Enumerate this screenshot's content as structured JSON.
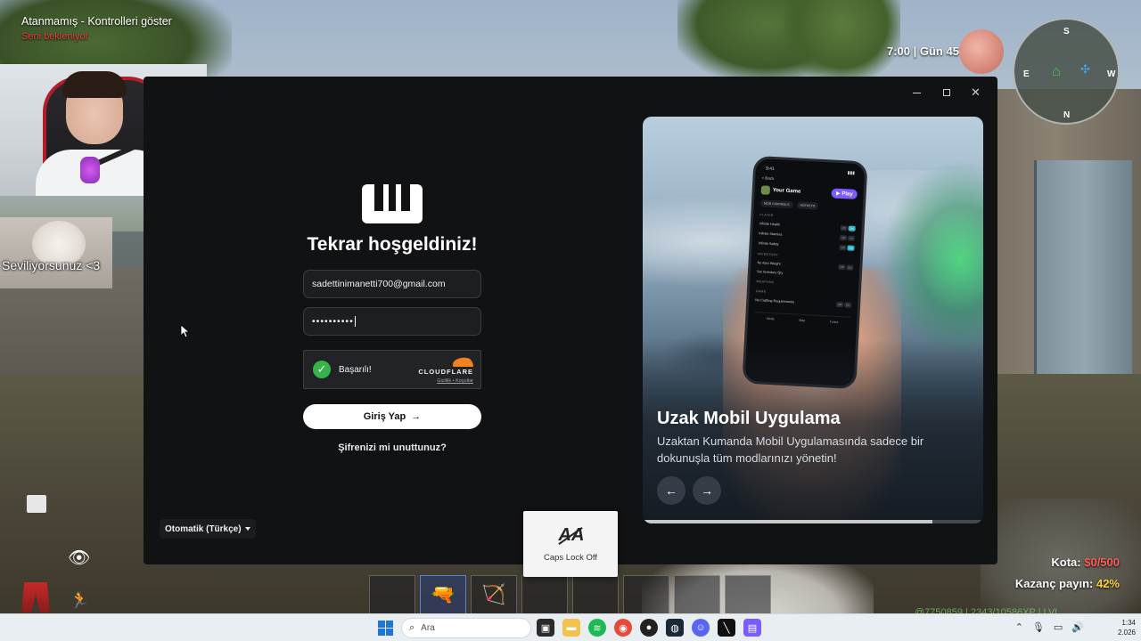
{
  "game": {
    "player_status": "Atanmamış - Kontrolleri göster",
    "sub_status": "Seni bekleniyor",
    "time_day": "7:00 | Gün 45",
    "compass": {
      "s": "S",
      "n": "N",
      "e": "E",
      "w": "W"
    },
    "hotbar_items": [
      "",
      "🔫",
      "🏹",
      "",
      "",
      "",
      "",
      ""
    ],
    "quota_label": "Kota:",
    "quota_value": "$0/500",
    "earnings_label": "Kazanç payın:",
    "earnings_value": "42%",
    "xp_line": "@7750859 | 2343/10586XP | LVL"
  },
  "stream_overlay": {
    "cat_caption": "Seviliyorsunuz <3"
  },
  "app": {
    "window_controls": {
      "minimize": "minimize",
      "maximize": "maximize",
      "close": "✕"
    },
    "title": "Tekrar hoşgeldiniz!",
    "email_value": "sadettinimanetti700@gmail.com",
    "password_value": "••••••••••",
    "captcha": {
      "status": "Başarılı!",
      "brand": "CLOUDFLARE",
      "links": "Gizlilik • Koşullar"
    },
    "login_button": "Giriş Yap",
    "login_arrow": "→",
    "forgot_password": "Şifrenizi mi unuttunuz?",
    "language": "Otomatik (Türkçe)",
    "promo": {
      "title": "Uzak Mobil Uygulama",
      "description": "Uzaktan Kumanda Mobil Uygulamasında sadece bir dokunuşla tüm modlarınızı yönetin!",
      "prev": "←",
      "next": "→",
      "progress": 0.85,
      "phone": {
        "time": "9:41",
        "back": "< Back",
        "game": "Your Game",
        "play": "▶ Play",
        "tab1": "MOD CONTROLS",
        "tab2": "HOTKEYS",
        "section_player": "PLAYER",
        "row1": "Infinite Health",
        "row2": "Infinite Stamina",
        "row3": "Infinite Safety",
        "section_inventory": "INVENTORY",
        "row4": "No Item Weight",
        "row5": "Set Inventory Qty",
        "section_weapons": "WEAPONS",
        "section_game": "GAME",
        "row6": "No Crafting Requirements",
        "toggle_off": "Off",
        "toggle_on": "On",
        "nav1": "Mods",
        "nav2": "Map",
        "nav3": "Tunes"
      }
    }
  },
  "caps_lock": {
    "icon": "A A",
    "label": "Caps Lock Off"
  },
  "taskbar": {
    "search_placeholder": "Ara",
    "clock_time": "1:34",
    "clock_date": "2.026"
  }
}
